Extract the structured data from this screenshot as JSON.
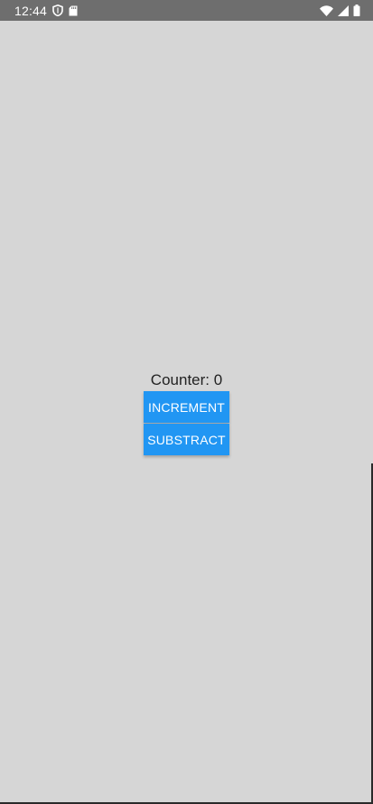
{
  "status_bar": {
    "time": "12:44",
    "background": "#6e6e6e",
    "left_icons": [
      "shield-icon",
      "sd-card-icon"
    ],
    "right_icons": [
      "wifi-icon",
      "cell-signal-icon",
      "battery-icon"
    ]
  },
  "app": {
    "background": "#d6d6d6",
    "counter_label": "Counter: 0",
    "increment_label": "INCREMENT",
    "subtract_label": "SUBSTRACT",
    "button_color": "#2196f3",
    "button_text_color": "#ffffff"
  }
}
